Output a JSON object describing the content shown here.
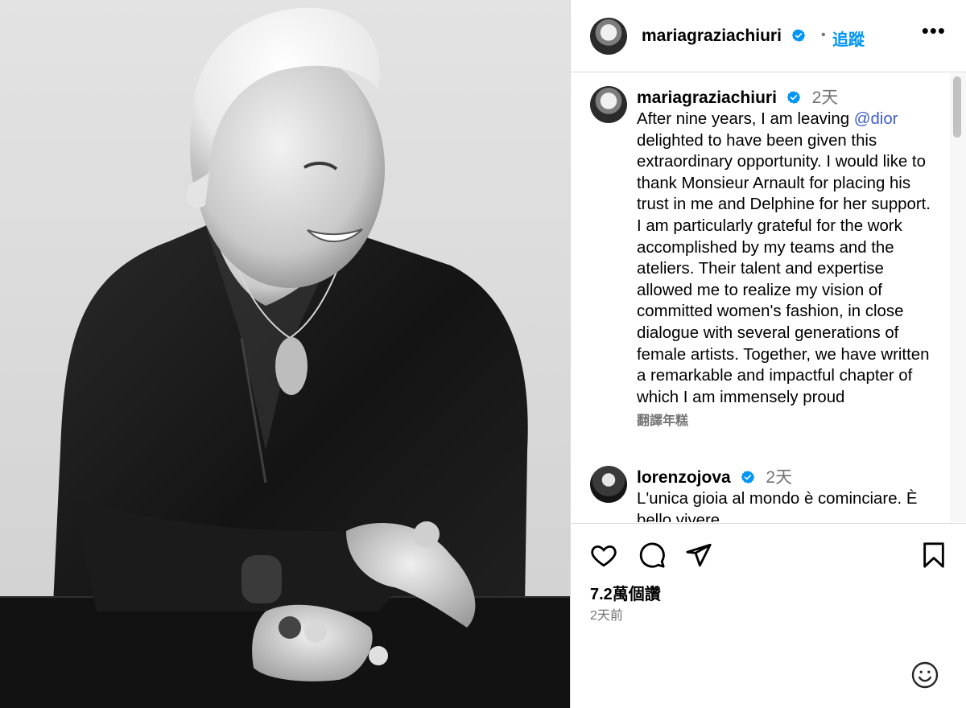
{
  "header": {
    "username": "mariagraziachiuri",
    "separator": "•",
    "follow_label": "追蹤",
    "more_label": "•••"
  },
  "caption": {
    "username": "mariagraziachiuri",
    "time": "2天",
    "text_before_mention": "After nine years, I am leaving ",
    "mention": "@dior",
    "text_after_mention": "delighted to have been given this extraordinary opportunity. I would like to thank Monsieur Arnault for placing his trust in me and Delphine for her support. I am particularly grateful for the work accomplished by my teams and the ateliers. Their talent and expertise allowed me to realize my vision of committed women's fashion, in close dialogue with several generations of female artists. Together, we have written a remarkable and impactful chapter of which I am immensely proud",
    "translate_label": "翻譯年糕"
  },
  "comment": {
    "username": "lorenzojova",
    "time": "2天",
    "text": "L'unica gioia al mondo è cominciare. È bello vivere"
  },
  "actions": {
    "like_icon": "heart-icon",
    "comment_icon": "comment-icon",
    "share_icon": "send-icon",
    "save_icon": "bookmark-icon",
    "likes": "7.2萬個讚",
    "posted": "2天前"
  },
  "colors": {
    "link": "#0095f6",
    "mention": "#3b5ecc",
    "verified": "#0095f6",
    "muted": "#737373"
  }
}
